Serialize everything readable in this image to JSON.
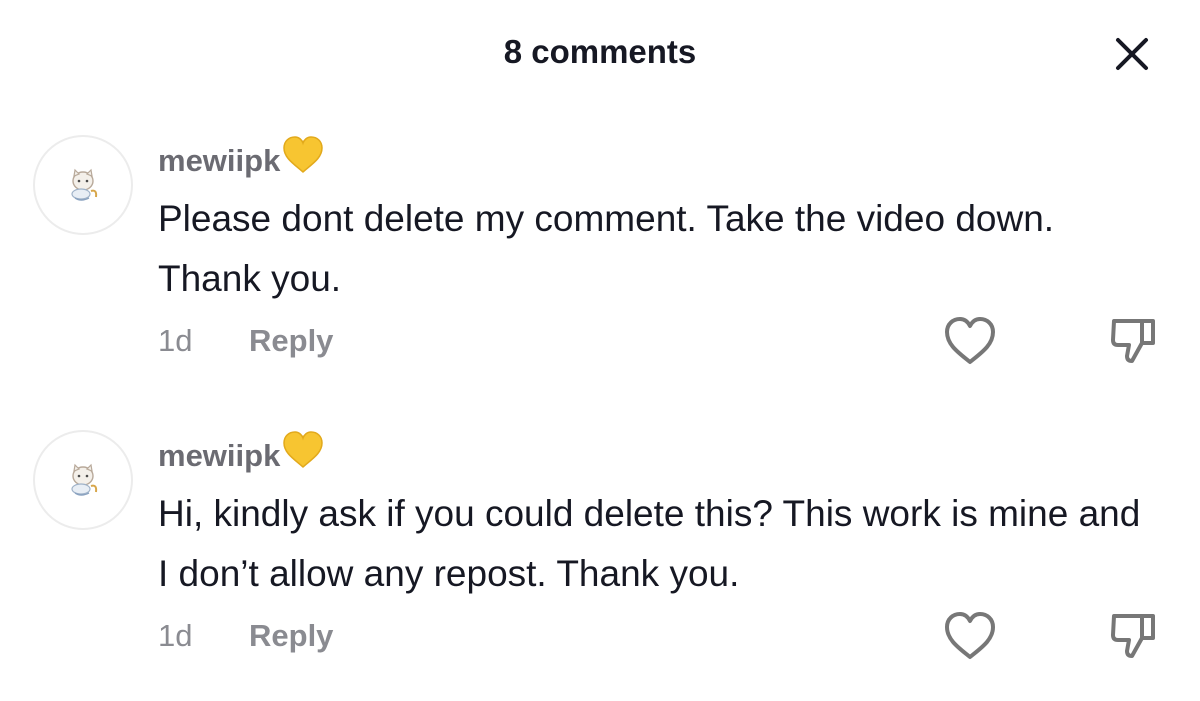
{
  "header": {
    "title": "8 comments"
  },
  "icons": {
    "close": "close-icon",
    "like": "heart-outline-icon",
    "dislike": "thumbs-down-icon",
    "username_badge": "yellow-heart-emoji"
  },
  "colors": {
    "text_primary": "#161823",
    "text_secondary": "#8a8b91",
    "username": "#6b6b72",
    "emoji_heart": "#f7c531",
    "icon_stroke": "#777777"
  },
  "comments": [
    {
      "username": "mewiipk",
      "text": "Please dont delete my comment. Take the video down. Thank you.",
      "time": "1d",
      "reply_label": "Reply"
    },
    {
      "username": "mewiipk",
      "text": "Hi, kindly ask if you could delete this? This work is mine and I don’t allow any repost. Thank you.",
      "time": "1d",
      "reply_label": "Reply"
    }
  ]
}
